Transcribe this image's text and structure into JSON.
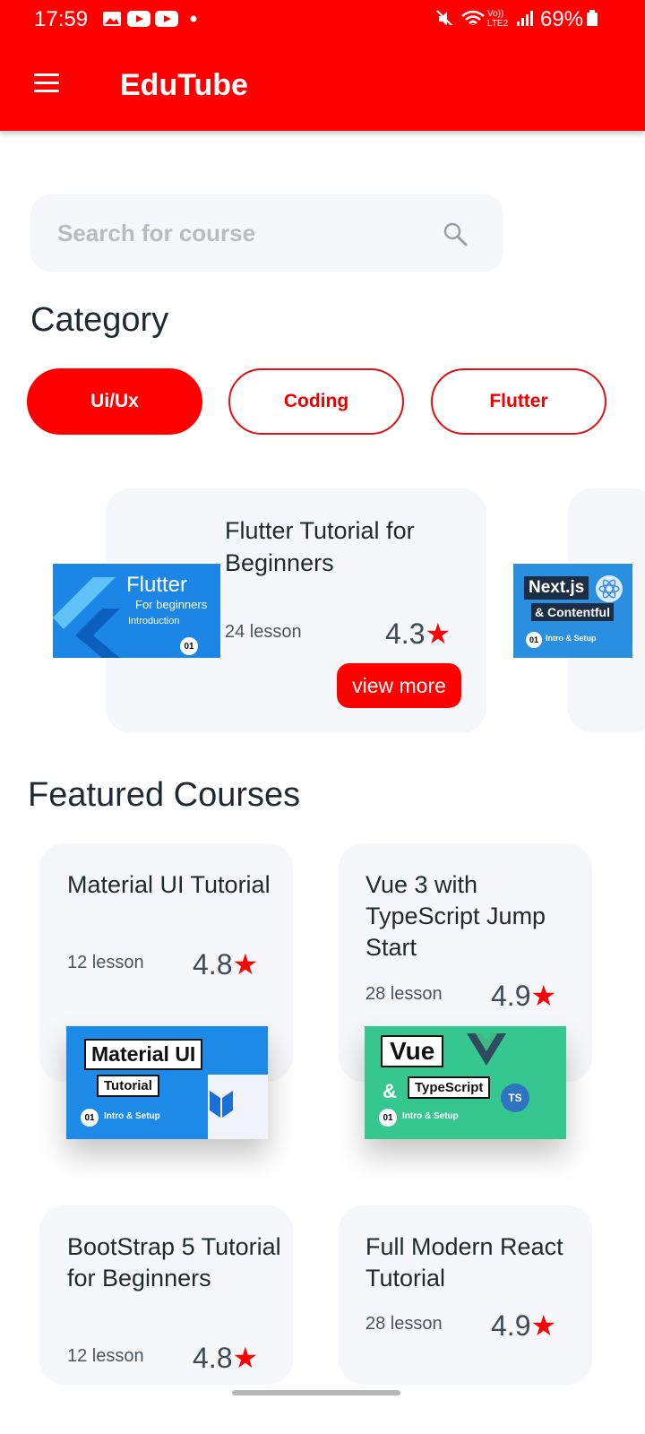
{
  "status": {
    "time": "17:59",
    "battery": "69%",
    "network": "Vo)) LTE2"
  },
  "app": {
    "title": "EduTube"
  },
  "search": {
    "placeholder": "Search for course"
  },
  "category": {
    "heading": "Category",
    "chips": [
      "Ui/Ux",
      "Coding",
      "Flutter"
    ],
    "active_chip": "Ui/Ux"
  },
  "category_cards": [
    {
      "title": "Flutter Tutorial for Beginners",
      "lessons": "24 lesson",
      "rating": "4.3",
      "button": "view more",
      "thumb": {
        "line1": "Flutter",
        "line2": "For beginners",
        "line3": "Introduction",
        "badge": "01"
      }
    },
    {
      "thumb": {
        "line1": "Next.js",
        "line2": "& Contentful",
        "line3": "Intro & Setup",
        "badge": "01"
      }
    }
  ],
  "featured": {
    "heading": "Featured Courses",
    "courses": [
      {
        "title": "Material UI Tutorial",
        "lessons": "12 lesson",
        "rating": "4.8",
        "thumb": {
          "line1": "Material UI",
          "line2": "Tutorial",
          "line3": "Intro & Setup",
          "badge": "01"
        }
      },
      {
        "title": "Vue 3 with TypeScript Jump Start",
        "lessons": "28 lesson",
        "rating": "4.9",
        "thumb": {
          "line1": "Vue",
          "line2": "TypeScript",
          "line3": "Intro & Setup",
          "badge": "01",
          "tag": "TS"
        }
      },
      {
        "title": "BootStrap 5 Tutorial for Beginners",
        "lessons": "12 lesson",
        "rating": "4.8"
      },
      {
        "title": "Full Modern React Tutorial",
        "lessons": "28 lesson",
        "rating": "4.9"
      }
    ]
  },
  "colors": {
    "accent": "#ff0000",
    "card": "#f5f7fa",
    "text": "#1f2a30"
  }
}
